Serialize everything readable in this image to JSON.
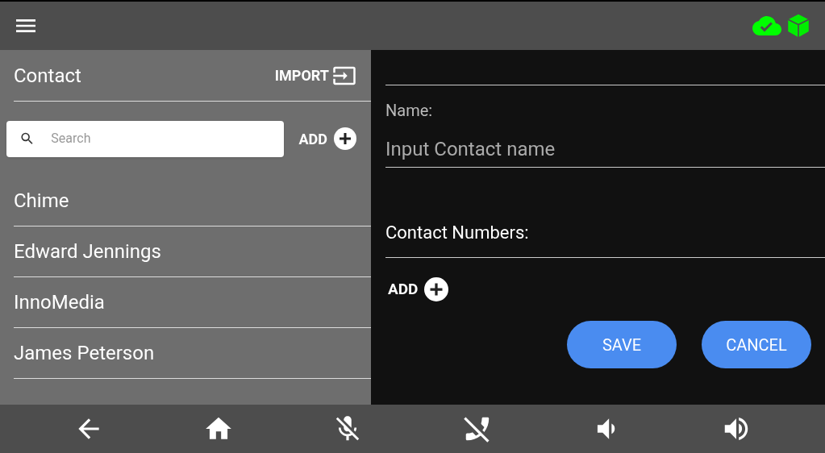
{
  "sidebar": {
    "title": "Contact",
    "import_label": "IMPORT",
    "search": {
      "placeholder": "Search"
    },
    "add_label": "ADD",
    "items": [
      {
        "name": "Chime"
      },
      {
        "name": "Edward Jennings"
      },
      {
        "name": "InnoMedia"
      },
      {
        "name": "James Peterson"
      }
    ]
  },
  "form": {
    "name_label": "Name:",
    "name_field": {
      "placeholder": "Input Contact name"
    },
    "numbers_label": "Contact Numbers:",
    "add_label": "ADD",
    "buttons": [
      "SAVE",
      "CANCEL"
    ]
  }
}
